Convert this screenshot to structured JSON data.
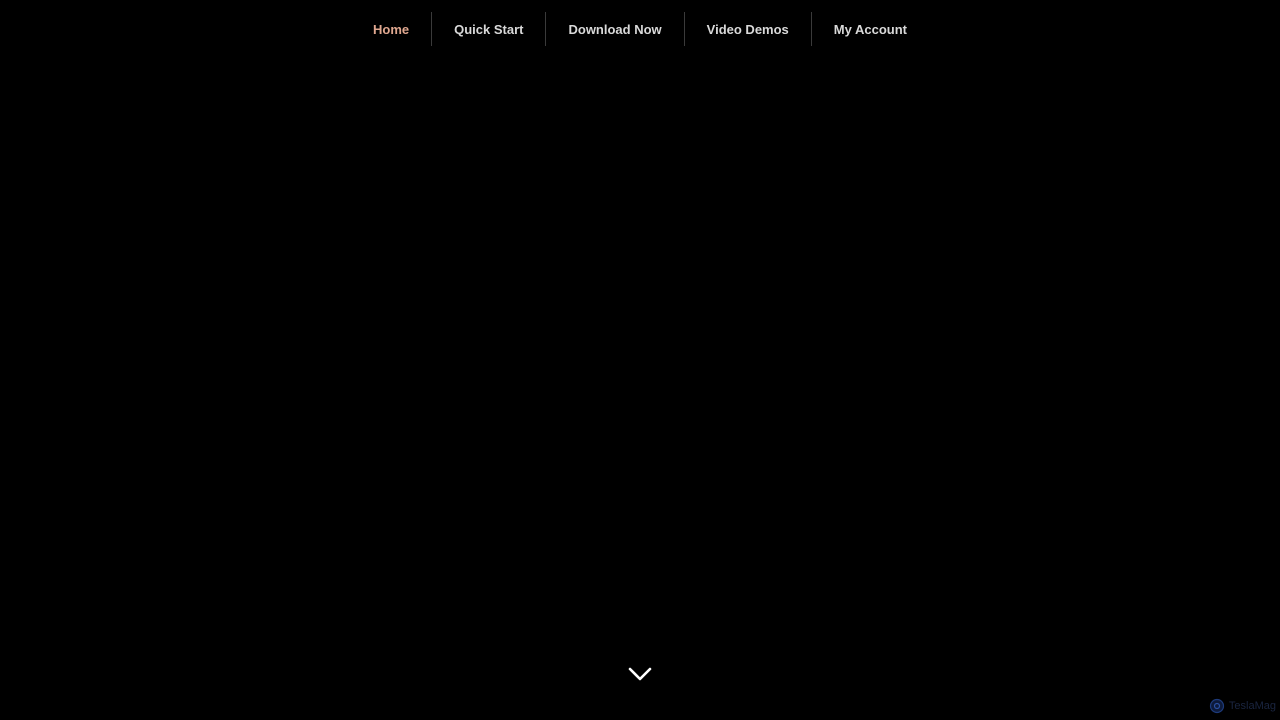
{
  "nav": {
    "items": [
      {
        "label": "Home",
        "active": true
      },
      {
        "label": "Quick Start",
        "active": false
      },
      {
        "label": "Download Now",
        "active": false
      },
      {
        "label": "Video Demos",
        "active": false
      },
      {
        "label": "My Account",
        "active": false
      }
    ]
  },
  "scroll_indicator": {
    "icon": "chevron-down-icon"
  },
  "badge": {
    "icon": "gear-icon",
    "label": "TeslaMag"
  },
  "colors": {
    "background": "#000000",
    "nav_text": "#d9d9d9",
    "nav_active": "#e0a890",
    "divider": "#3a3a3a",
    "badge": "#1a2540"
  }
}
